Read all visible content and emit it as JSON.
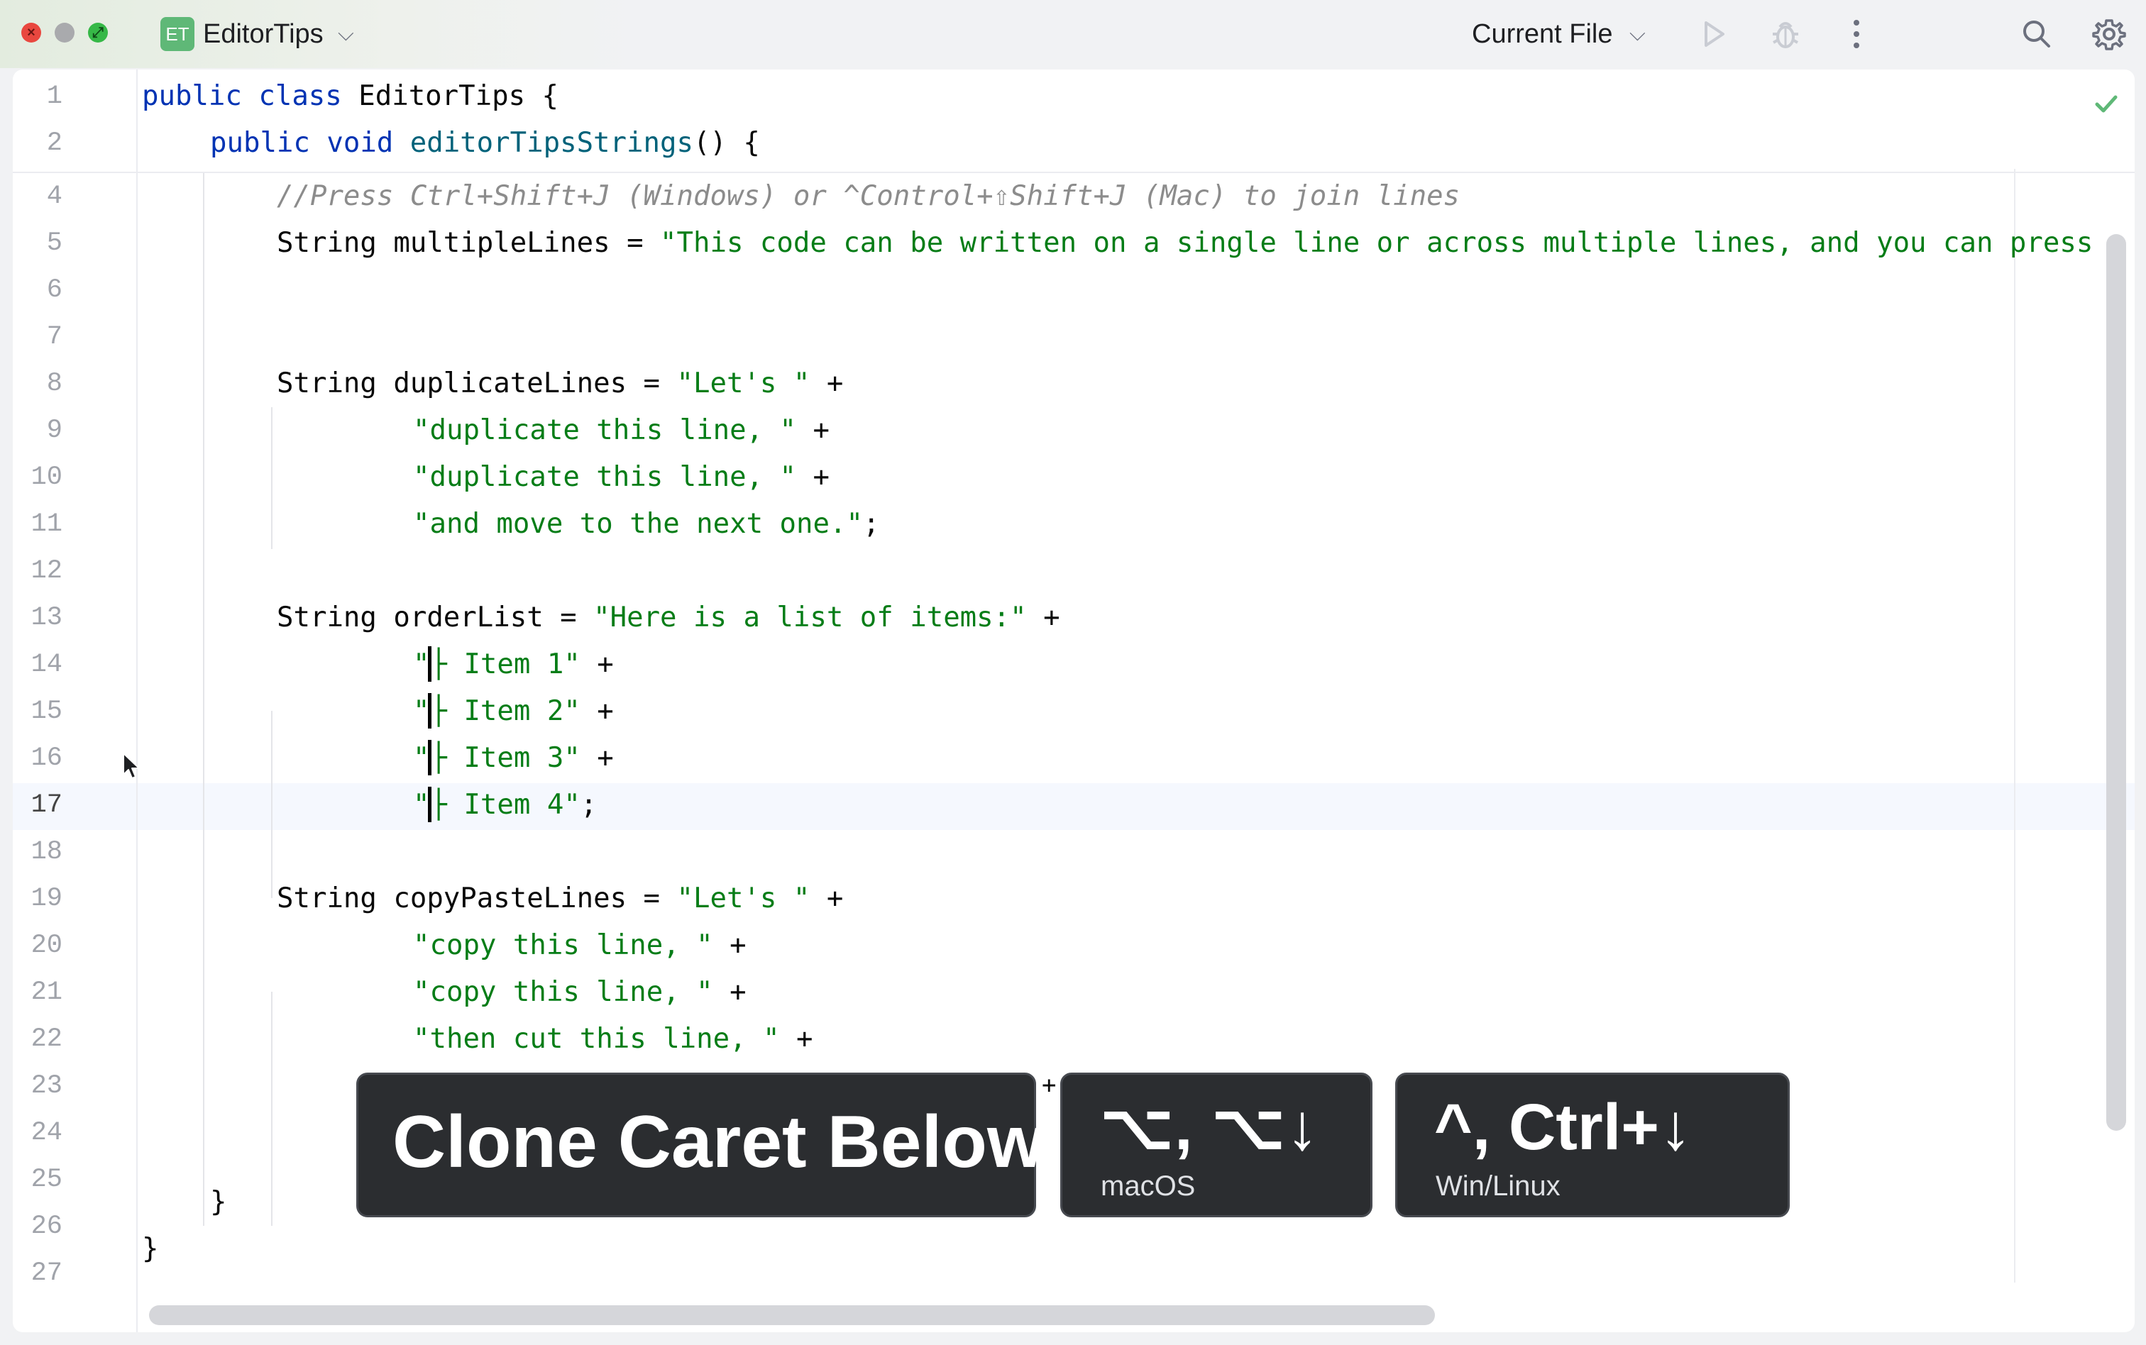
{
  "window": {
    "project_badge": "ET",
    "project_name": "EditorTips",
    "run_config": "Current File",
    "icons": [
      "close-window-icon",
      "minimize-window-icon",
      "zoom-window-icon",
      "chevron-down-icon",
      "run-icon",
      "debug-icon",
      "more-icon",
      "search-icon",
      "settings-icon",
      "check-icon"
    ]
  },
  "editor": {
    "current_line": "17",
    "line_numbers": [
      "1",
      "2",
      "4",
      "5",
      "6",
      "7",
      "8",
      "9",
      "10",
      "11",
      "12",
      "13",
      "14",
      "15",
      "16",
      "17",
      "18",
      "19",
      "20",
      "21",
      "22",
      "23",
      "24",
      "25",
      "26",
      "27"
    ],
    "code": {
      "l1_kw": "public class ",
      "l1_rest": "EditorTips {",
      "l2_kw": "public void ",
      "l2_fn": "editorTipsStrings",
      "l2_rest": "() {",
      "l4_comment": "//Press Ctrl+Shift+J (Windows) or ^Control+⇧Shift+J (Mac) to join lines",
      "l5_code": "String multipleLines = ",
      "l5_str": "\"This code can be written on a single line or across multiple lines, and you can press",
      "l8_code": "String duplicateLines = ",
      "l8_str": "\"Let's \"",
      "plus": " +",
      "l9_str": "\"duplicate this line, \"",
      "l10_str": "\"duplicate this line, \"",
      "l11_str": "\"and move to the next one.\"",
      "semicolon": ";",
      "l13_code": "String orderList = ",
      "l13_str": "\"Here is a list of items:\"",
      "quote": "\"",
      "l14_str": "├ Item 1\"",
      "l15_str": "├ Item 2\"",
      "l16_str": "├ Item 3\"",
      "l17_str": "├ Item 4\"",
      "l19_code": "String copyPasteLines = ",
      "l19_str": "\"Let's \"",
      "l20_str": "\"copy this line, \"",
      "l21_str": "\"copy this line, \"",
      "l22_str": "\"then cut this line, \"",
      "l23_partial": "+",
      "l25_brace": "}",
      "l26_brace": "}"
    }
  },
  "overlay": {
    "action": "Clone Caret Below",
    "mac_keys": "⌥, ⌥↓",
    "mac_label": "macOS",
    "win_keys": "^, Ctrl+↓",
    "win_label": "Win/Linux"
  }
}
